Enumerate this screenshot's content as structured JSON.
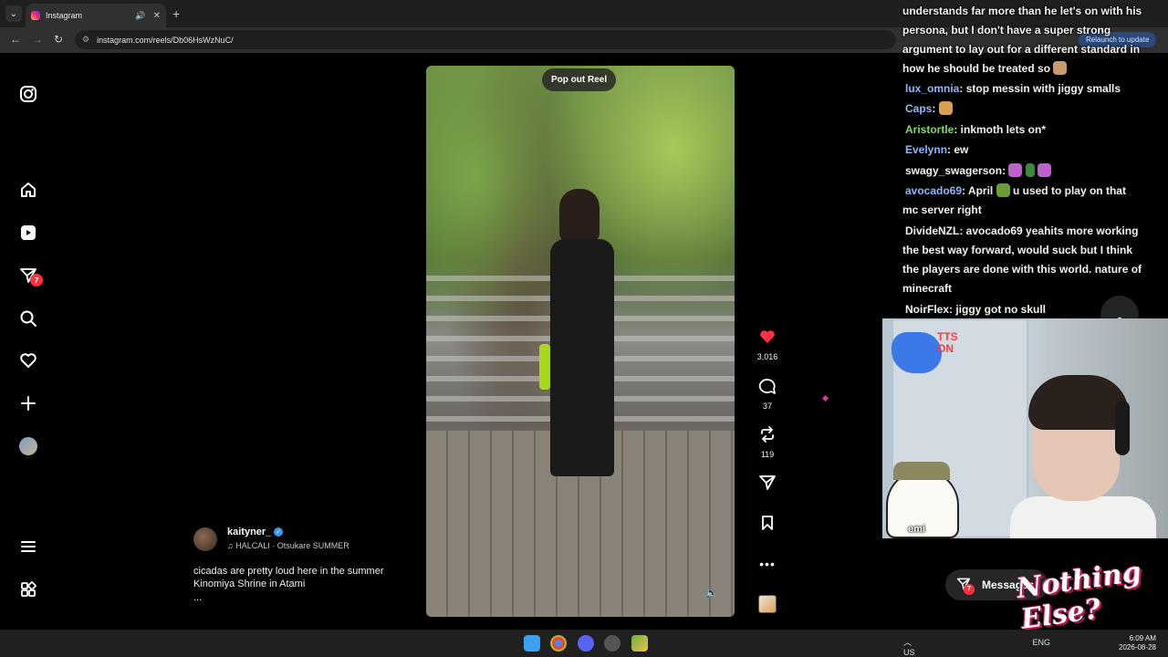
{
  "browser": {
    "tab_title": "Instagram",
    "url": "instagram.com/reels/Db06HsWzNuC/",
    "relaunch_label": "Relaunch to update"
  },
  "nav": {
    "notifications_badge": "7",
    "items": [
      "instagram-logo",
      "home",
      "reels",
      "messages",
      "search",
      "notifications",
      "create",
      "profile",
      "more",
      "also-from-meta"
    ]
  },
  "reel": {
    "pop_out_label": "Pop out Reel",
    "likes": "3,016",
    "comments": "37",
    "reposts": "119",
    "author": "kaityner_",
    "audio": "HALCALI · Otsukare SUMMER",
    "caption_line1": "cicadas are pretty loud here in the summer",
    "caption_line2": "Kinomiya Shrine in Atami",
    "caption_more": "..."
  },
  "chat": {
    "lines": [
      {
        "user": "",
        "text": "understands far more than he let's on with his"
      },
      {
        "user": "",
        "text": "persona, but I don't have a super strong"
      },
      {
        "user": "",
        "text": "argument to lay out for a different standard in"
      },
      {
        "user": "",
        "text": "how he should be treated so"
      },
      {
        "user": "lux_omnia",
        "text": ": stop messin with jiggy smalls",
        "color": "#8fb6ff"
      },
      {
        "user": "Caps",
        "text": ":",
        "color": "#8fb6ff"
      },
      {
        "user": "Aristortle",
        "text": ": inkmoth lets on*",
        "color": "#7fd86a"
      },
      {
        "user": "Evelynn",
        "text": ": ew",
        "color": "#8fb6ff"
      },
      {
        "user": "swagy_swagerson",
        "text": ":",
        "color": "#f2f2f2"
      },
      {
        "user": "avocado69",
        "text": ": April",
        "color": "#8fb6ff"
      },
      {
        "user": "",
        "text": "u used to play on that"
      },
      {
        "user": "",
        "text": "mc server right"
      },
      {
        "user": "DivideNZL",
        "text": ": avocado69 yeahits more working",
        "color": "#f2f2f2"
      },
      {
        "user": "",
        "text": "the best way forward, would suck but I think"
      },
      {
        "user": "",
        "text": "the players are done with this world. nature of"
      },
      {
        "user": "",
        "text": "minecraft"
      },
      {
        "user": "NoirFlex",
        "text": ": jiggy got no skull",
        "color": "#f2f2f2"
      }
    ]
  },
  "webcam": {
    "tts_label": "TTS\nON",
    "emi_label": "emi"
  },
  "messages": {
    "label": "Messages",
    "badge": "7"
  },
  "logo_text": "Nothing Else?",
  "taskbar": {
    "lang": "ENG",
    "region": "US",
    "time": "6:09 AM",
    "date": "2026-08-28"
  }
}
